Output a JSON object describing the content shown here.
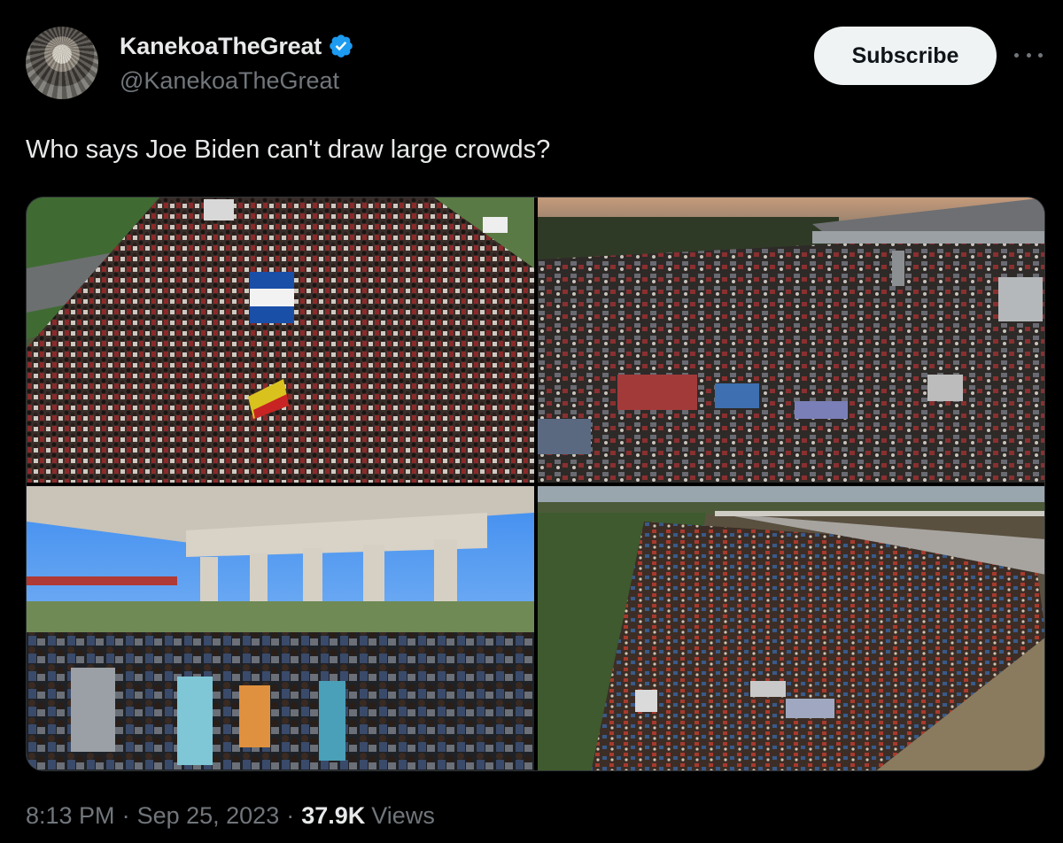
{
  "author": {
    "display_name": "KanekoaTheGreat",
    "handle": "@KanekoaTheGreat",
    "verified_icon": "verified-badge-icon",
    "verified_color": "#1d9bf0"
  },
  "actions": {
    "subscribe_label": "Subscribe",
    "more_icon": "more-options-icon"
  },
  "tweet": {
    "text": "Who says Joe Biden can't draw large crowds?"
  },
  "media": [
    {
      "icon": "photo-crowd-marching-icon"
    },
    {
      "icon": "photo-camp-under-bridge-icon"
    },
    {
      "icon": "photo-crowd-under-overpass-icon"
    },
    {
      "icon": "photo-aerial-camp-icon"
    }
  ],
  "meta": {
    "time": "8:13 PM",
    "separator": "·",
    "date": "Sep 25, 2023",
    "views_count": "37.9K",
    "views_label": "Views"
  },
  "colors": {
    "background": "#000000",
    "text_primary": "#e7e9ea",
    "text_secondary": "#71767b",
    "button_bg": "#eff3f4"
  }
}
